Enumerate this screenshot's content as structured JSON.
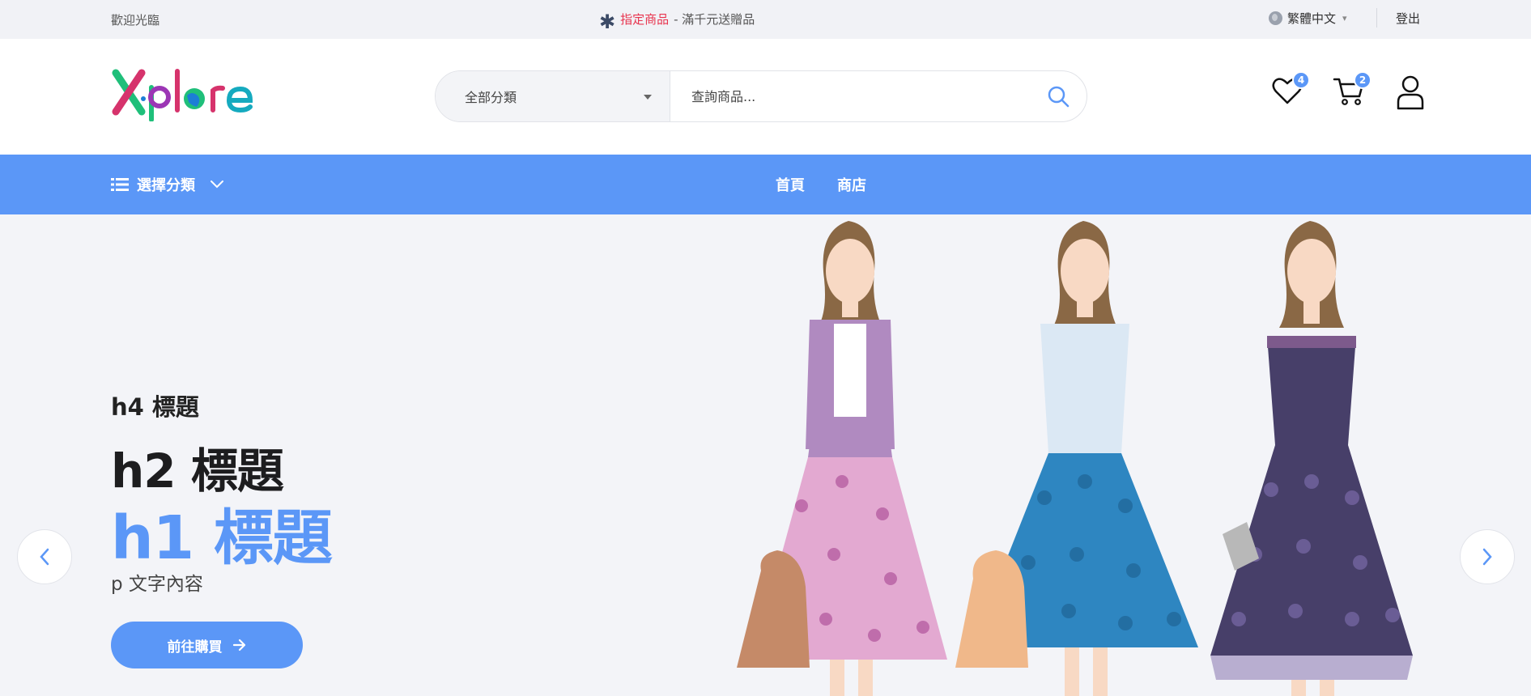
{
  "topbar": {
    "welcome": "歡迎光臨",
    "promo_highlight": "指定商品",
    "promo_text": " - 滿千元送贈品",
    "language": "繁體中文",
    "logout": "登出"
  },
  "header": {
    "logo_text": "Xplore",
    "search": {
      "category": "全部分類",
      "placeholder": "查詢商品..."
    },
    "wishlist_count": "4",
    "cart_count": "2"
  },
  "nav": {
    "category_select": "選擇分類",
    "menu": [
      "首頁",
      "商店"
    ]
  },
  "hero": {
    "h4": "h4 標題",
    "h2": "h2 標題",
    "h1": "h1 標題",
    "p": "p 文字內容",
    "cta": "前往購買"
  },
  "colors": {
    "accent": "#5b97f7",
    "promo_red": "#e8344e",
    "topbar_bg": "#f1f2f6",
    "hero_bg": "#f3f4f8"
  },
  "icons": {
    "search": "search-icon",
    "wishlist": "heart-icon",
    "cart": "cart-icon",
    "account": "user-icon",
    "language": "globe-icon",
    "menu": "list-icon"
  }
}
